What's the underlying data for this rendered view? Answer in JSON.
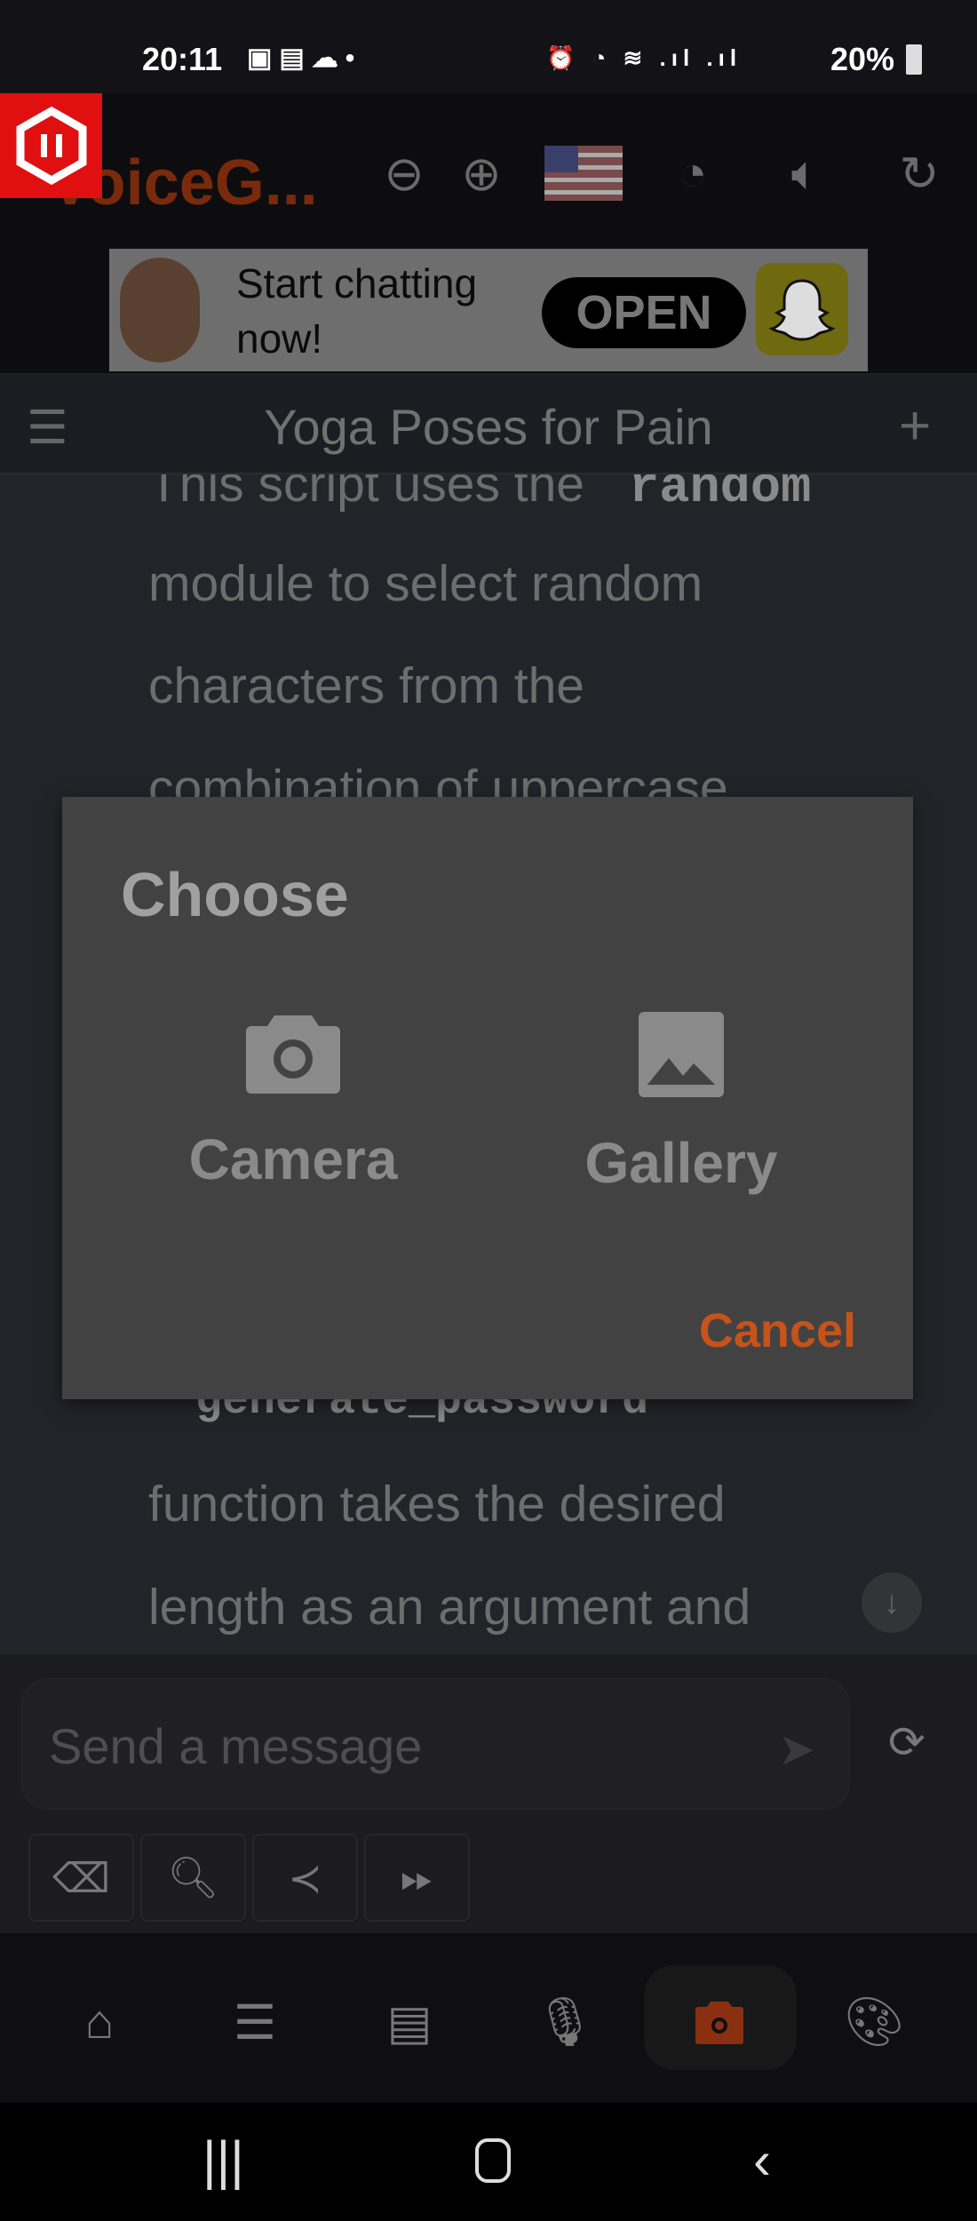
{
  "status_bar": {
    "time": "20:11",
    "battery": "20%",
    "left_icons": [
      "gallery-icon",
      "notification-icon",
      "cloud-icon",
      "dot-icon"
    ],
    "right_icons": [
      "android-icon",
      "alarm-icon",
      "wifi-icon",
      "signal-lte1",
      "signal-lte2",
      "battery-icon"
    ]
  },
  "header": {
    "app_name": "VoiceG...",
    "icons": [
      "zoom-out-icon",
      "zoom-in-icon",
      "us-flag-icon",
      "speedometer-icon",
      "volume-icon",
      "refresh-icon"
    ]
  },
  "ad": {
    "text": "Start chatting now!",
    "button": "OPEN"
  },
  "titlebar": {
    "title": "Yoga Poses for Pain"
  },
  "content": {
    "line1_prefix": "This script uses the ",
    "line1_code": "`random`",
    "line2": "module to select random",
    "line3": "characters from the",
    "line4": "combination of uppercase",
    "code_line": "`generate_password`",
    "line6": "function takes the desired",
    "line7": "length as an argument and"
  },
  "dialog": {
    "title": "Choose",
    "options": [
      {
        "label": "Camera",
        "icon": "camera-icon"
      },
      {
        "label": "Gallery",
        "icon": "image-icon"
      }
    ],
    "cancel": "Cancel"
  },
  "input": {
    "placeholder": "Send a message",
    "value": ""
  },
  "tools": [
    "eraser-icon",
    "web-search-icon",
    "share-icon",
    "fast-forward-icon"
  ],
  "bottom_nav": {
    "items": [
      "home",
      "menu",
      "chat",
      "microphone",
      "camera",
      "palette"
    ],
    "active": "camera"
  },
  "colors": {
    "accent": "#c5531a",
    "dialog_bg": "#424242",
    "logo_red": "#e01010"
  }
}
